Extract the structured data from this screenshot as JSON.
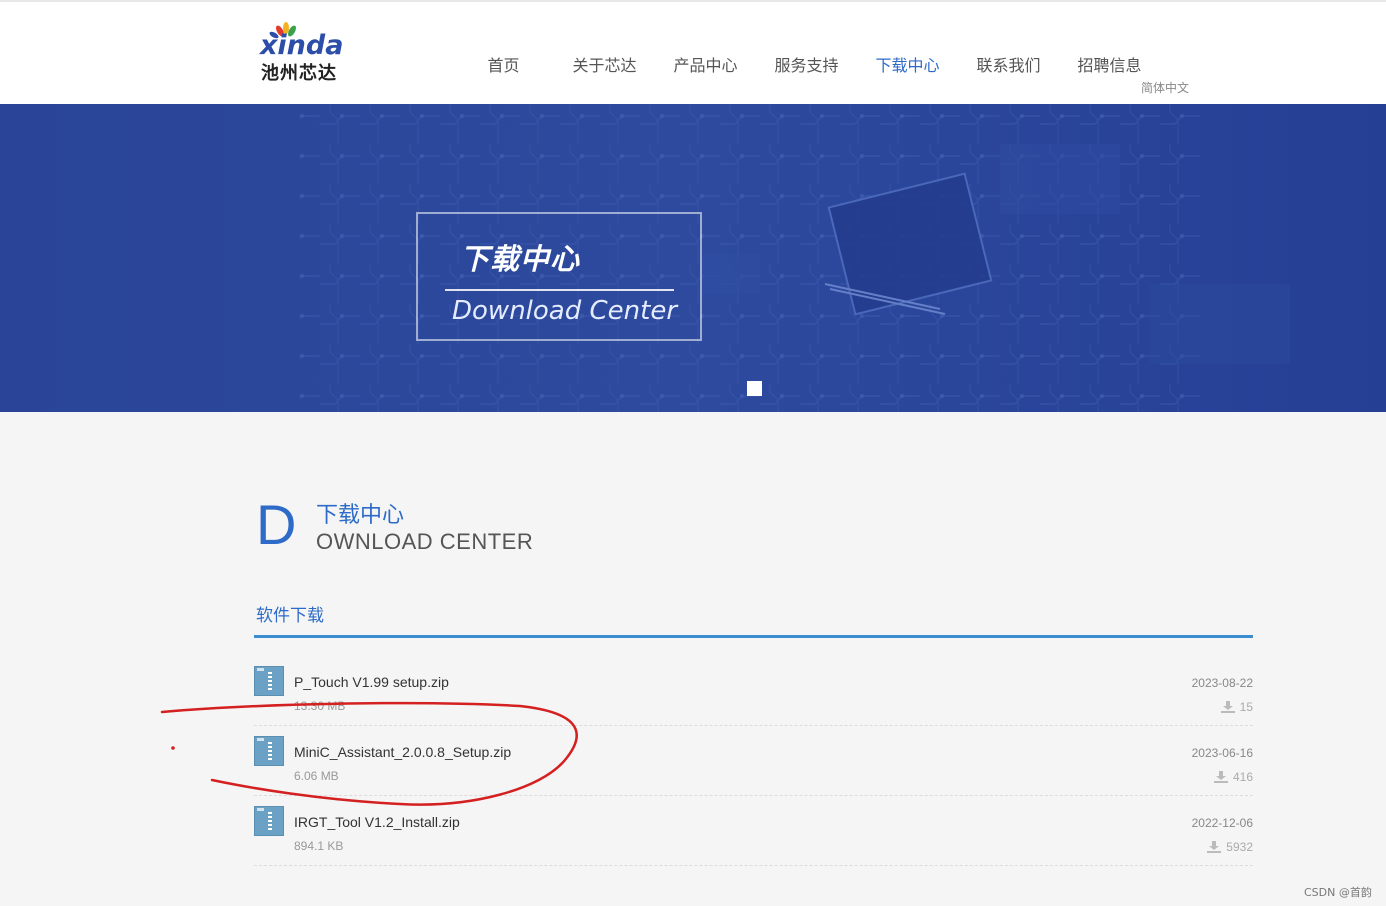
{
  "brand": {
    "latin": "xinda",
    "name_cn": "池州芯达"
  },
  "nav": {
    "items": [
      {
        "label": "首页",
        "active": false
      },
      {
        "label": "关于芯达",
        "active": false
      },
      {
        "label": "产品中心",
        "active": false
      },
      {
        "label": "服务支持",
        "active": false
      },
      {
        "label": "下载中心",
        "active": true
      },
      {
        "label": "联系我们",
        "active": false
      },
      {
        "label": "招聘信息",
        "active": false
      }
    ],
    "language": "简体中文"
  },
  "banner": {
    "title_cn": "下载中心",
    "title_en": "Download Center"
  },
  "section": {
    "initial": "D",
    "title_cn": "下载中心",
    "title_en_rest": "OWNLOAD CENTER"
  },
  "category": {
    "label": "软件下载"
  },
  "downloads": [
    {
      "name": "P_Touch V1.99 setup.zip",
      "size": "13.30 MB",
      "date": "2023-08-22",
      "count": "15"
    },
    {
      "name": "MiniC_Assistant_2.0.0.8_Setup.zip",
      "size": "6.06 MB",
      "date": "2023-06-16",
      "count": "416"
    },
    {
      "name": "IRGT_Tool V1.2_Install.zip",
      "size": "894.1 KB",
      "date": "2022-12-06",
      "count": "5932"
    }
  ],
  "annotation": {
    "circled_item": "MiniC_Assistant_2.0.0.8_Setup.zip",
    "color": "#d42020"
  },
  "watermark": "CSDN @首韵",
  "colors": {
    "accent": "#2e6bc8",
    "banner_bg": "#2a4597",
    "category_bar": "#3a8ed0"
  }
}
